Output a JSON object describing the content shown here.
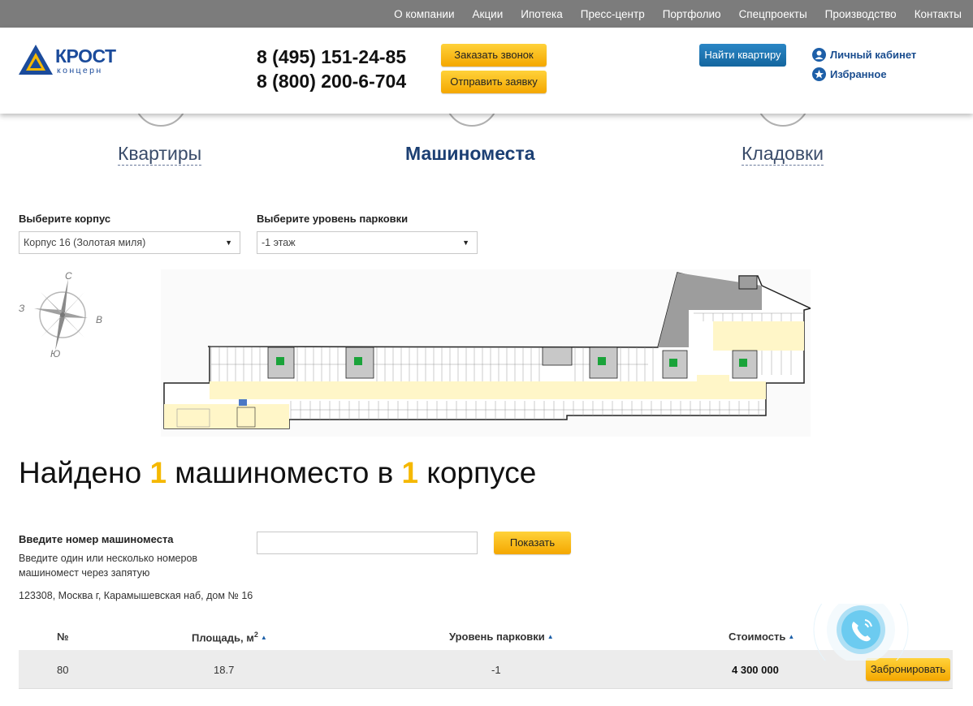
{
  "nav": {
    "items": [
      "О компании",
      "Акции",
      "Ипотека",
      "Пресс-центр",
      "Портфолио",
      "Спецпроекты",
      "Производство",
      "Контакты"
    ]
  },
  "header": {
    "logo_text": "КРОСТ",
    "logo_sub": "концерн",
    "phone1": "8 (495) 151-24-85",
    "phone2": "8 (800) 200-6-704",
    "call_button": "Заказать звонок",
    "request_button": "Отправить заявку",
    "find_button": "Найти квартиру",
    "cabinet_link": "Личный кабинет",
    "favorites_link": "Избранное"
  },
  "categories": {
    "apartments": "Квартиры",
    "parking": "Машиноместа",
    "storage": "Кладовки"
  },
  "filters": {
    "building_label": "Выберите корпус",
    "building_value": "Корпус 16 (Золотая миля)",
    "level_label": "Выберите уровень парковки",
    "level_value": "-1 этаж"
  },
  "compass": {
    "n": "С",
    "e": "В",
    "s": "Ю",
    "w": "З"
  },
  "result": {
    "part1": "Найдено ",
    "count": "1",
    "part2": " машиноместо в ",
    "buildings": "1",
    "part3": " корпусе"
  },
  "search": {
    "label": "Введите номер машиноместа",
    "hint": "Введите один или несколько номеров машиномест через запятую",
    "input_value": "",
    "button": "Показать"
  },
  "address": "123308, Москва г, Карамышевская наб, дом № 16",
  "table": {
    "headers": {
      "num": "№",
      "area": "Площадь, м",
      "area_sup": "2",
      "level": "Уровень парковки",
      "price": "Стоимость"
    },
    "rows": [
      {
        "num": "80",
        "area": "18.7",
        "level": "-1",
        "price": "4 300 000",
        "action": "Забронировать"
      }
    ]
  },
  "colors": {
    "accent_yellow": "#f5b800",
    "brand_blue": "#1b4b9b",
    "nav_gray": "#7c7c7c"
  }
}
